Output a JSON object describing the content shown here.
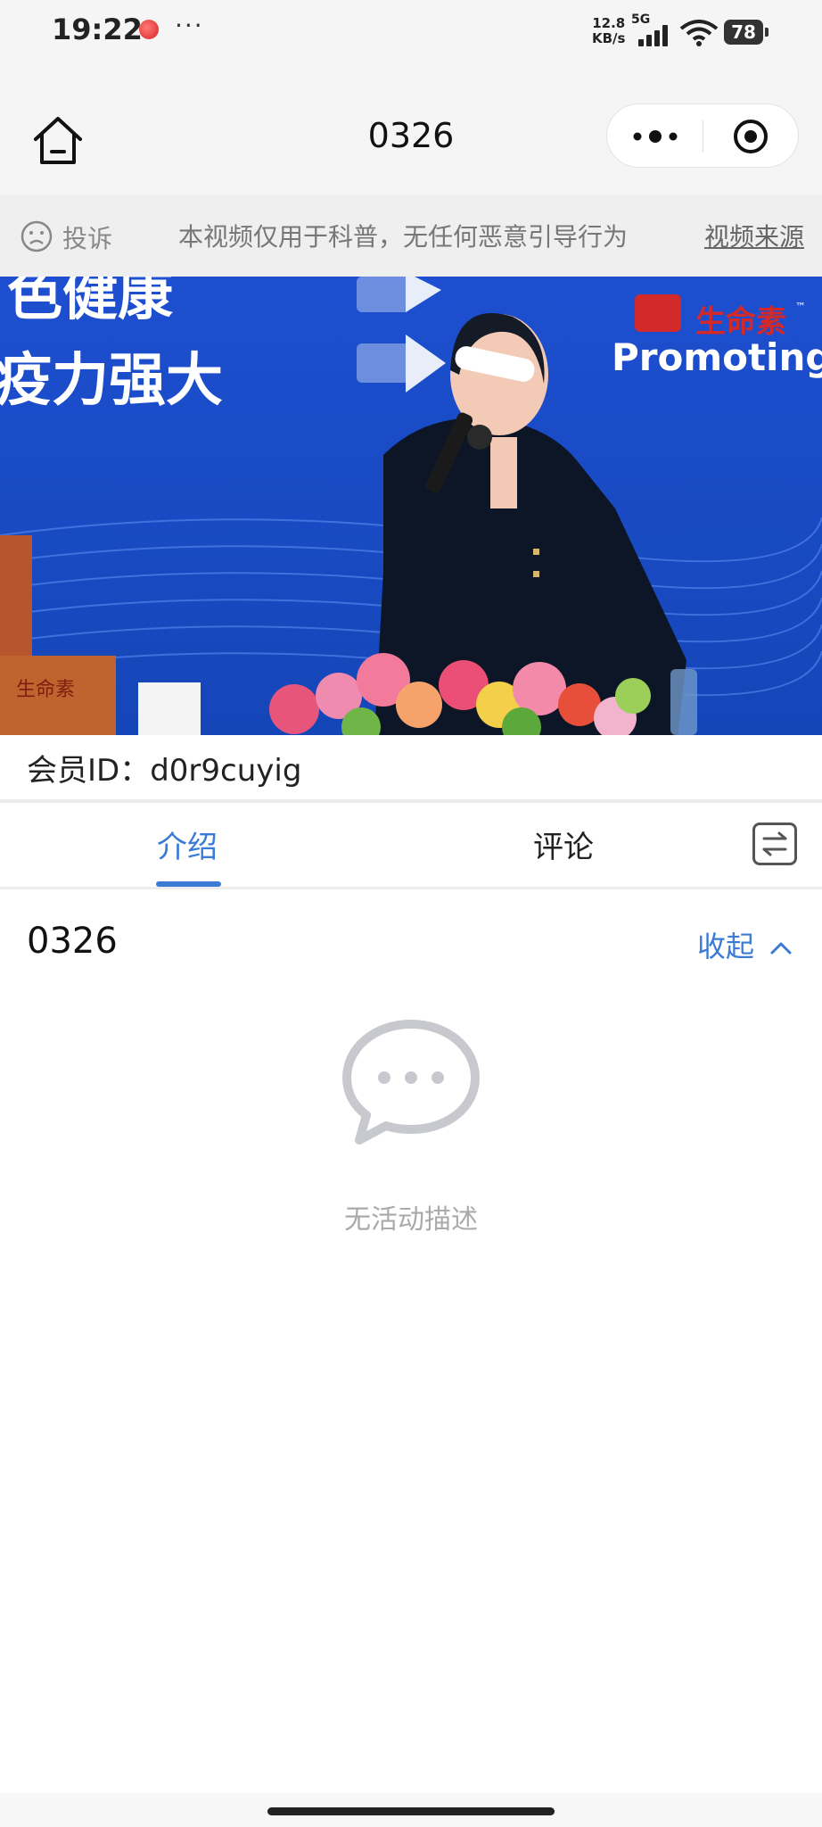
{
  "status_bar": {
    "time": "19:22",
    "net_speed_value": "12.8",
    "net_speed_unit": "KB/s",
    "network": "5G",
    "battery": "78"
  },
  "nav": {
    "title": "0326",
    "home_icon": "home-icon",
    "more_icon": "more-dots-icon",
    "close_icon": "target-close-icon"
  },
  "notice": {
    "complain_label": "投诉",
    "marquee_text": "本视频仅用于科普，无任何恶意引导行为",
    "source_link": "视频来源"
  },
  "video": {
    "banner_line1": "色健康",
    "banner_line2": "疫力强大",
    "brand": "生命素",
    "brand_tm": "™",
    "promo_text": "Promoting",
    "box_label": "生命素"
  },
  "member": {
    "label": "会员ID：",
    "id": "d0r9cuyig"
  },
  "tabs": {
    "intro": "介绍",
    "comment": "评论",
    "active": "intro"
  },
  "content": {
    "title": "0326",
    "collapse_label": "收起",
    "empty_text": "无活动描述"
  },
  "colors": {
    "accent": "#3a7bd5",
    "bar_bg": "#f5f5f5",
    "notice_bg": "#efefef"
  }
}
